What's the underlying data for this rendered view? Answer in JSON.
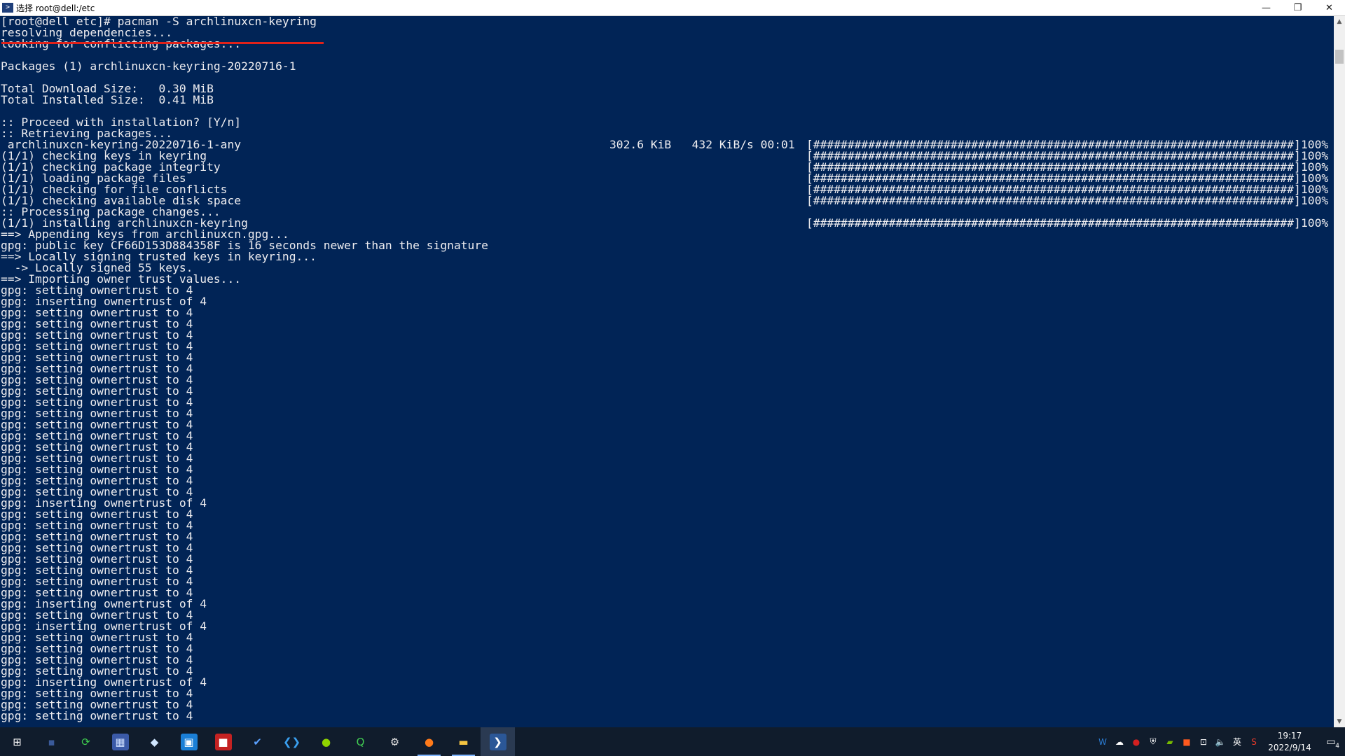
{
  "window": {
    "icon_name": "powershell-icon",
    "title": "选择 root@dell:/etc",
    "controls": {
      "minimize": "—",
      "maximize": "❐",
      "close": "✕"
    }
  },
  "console": {
    "lines": [
      {
        "text": "[root@dell etc]# pacman -S archlinuxcn-keyring"
      },
      {
        "text": "resolving dependencies..."
      },
      {
        "text": "looking for conflicting packages..."
      },
      {
        "text": ""
      },
      {
        "text": "Packages (1) archlinuxcn-keyring-20220716-1"
      },
      {
        "text": ""
      },
      {
        "text": "Total Download Size:   0.30 MiB"
      },
      {
        "text": "Total Installed Size:  0.41 MiB"
      },
      {
        "text": ""
      },
      {
        "text": ":: Proceed with installation? [Y/n]"
      },
      {
        "text": ":: Retrieving packages..."
      },
      {
        "text": " archlinuxcn-keyring-20220716-1-any",
        "stats": "302.6 KiB   432 KiB/s 00:01",
        "bar": "[######################################################################]",
        "pct": "100%"
      },
      {
        "text": "(1/1) checking keys in keyring",
        "bar": "[######################################################################]",
        "pct": "100%"
      },
      {
        "text": "(1/1) checking package integrity",
        "bar": "[######################################################################]",
        "pct": "100%"
      },
      {
        "text": "(1/1) loading package files",
        "bar": "[######################################################################]",
        "pct": "100%"
      },
      {
        "text": "(1/1) checking for file conflicts",
        "bar": "[######################################################################]",
        "pct": "100%"
      },
      {
        "text": "(1/1) checking available disk space",
        "bar": "[######################################################################]",
        "pct": "100%"
      },
      {
        "text": ":: Processing package changes..."
      },
      {
        "text": "(1/1) installing archlinuxcn-keyring",
        "bar": "[######################################################################]",
        "pct": "100%"
      },
      {
        "text": "==> Appending keys from archlinuxcn.gpg..."
      },
      {
        "text": "gpg: public key CF66D153D884358F is 16 seconds newer than the signature"
      },
      {
        "text": "==> Locally signing trusted keys in keyring..."
      },
      {
        "text": "  -> Locally signed 55 keys."
      },
      {
        "text": "==> Importing owner trust values..."
      },
      {
        "text": "gpg: setting ownertrust to 4"
      },
      {
        "text": "gpg: inserting ownertrust of 4"
      },
      {
        "text": "gpg: setting ownertrust to 4"
      },
      {
        "text": "gpg: setting ownertrust to 4"
      },
      {
        "text": "gpg: setting ownertrust to 4"
      },
      {
        "text": "gpg: setting ownertrust to 4"
      },
      {
        "text": "gpg: setting ownertrust to 4"
      },
      {
        "text": "gpg: setting ownertrust to 4"
      },
      {
        "text": "gpg: setting ownertrust to 4"
      },
      {
        "text": "gpg: setting ownertrust to 4"
      },
      {
        "text": "gpg: setting ownertrust to 4"
      },
      {
        "text": "gpg: setting ownertrust to 4"
      },
      {
        "text": "gpg: setting ownertrust to 4"
      },
      {
        "text": "gpg: setting ownertrust to 4"
      },
      {
        "text": "gpg: setting ownertrust to 4"
      },
      {
        "text": "gpg: setting ownertrust to 4"
      },
      {
        "text": "gpg: setting ownertrust to 4"
      },
      {
        "text": "gpg: setting ownertrust to 4"
      },
      {
        "text": "gpg: setting ownertrust to 4"
      },
      {
        "text": "gpg: inserting ownertrust of 4"
      },
      {
        "text": "gpg: setting ownertrust to 4"
      },
      {
        "text": "gpg: setting ownertrust to 4"
      },
      {
        "text": "gpg: setting ownertrust to 4"
      },
      {
        "text": "gpg: setting ownertrust to 4"
      },
      {
        "text": "gpg: setting ownertrust to 4"
      },
      {
        "text": "gpg: setting ownertrust to 4"
      },
      {
        "text": "gpg: setting ownertrust to 4"
      },
      {
        "text": "gpg: setting ownertrust to 4"
      },
      {
        "text": "gpg: inserting ownertrust of 4"
      },
      {
        "text": "gpg: setting ownertrust to 4"
      },
      {
        "text": "gpg: inserting ownertrust of 4"
      },
      {
        "text": "gpg: setting ownertrust to 4"
      },
      {
        "text": "gpg: setting ownertrust to 4"
      },
      {
        "text": "gpg: setting ownertrust to 4"
      },
      {
        "text": "gpg: setting ownertrust to 4"
      },
      {
        "text": "gpg: inserting ownertrust of 4"
      },
      {
        "text": "gpg: setting ownertrust to 4"
      },
      {
        "text": "gpg: setting ownertrust to 4"
      },
      {
        "text": "gpg: setting ownertrust to 4"
      }
    ],
    "colors": {
      "background": "#012456",
      "foreground": "#eeedf0",
      "highlight_underline": "#e0221a"
    }
  },
  "taskbar": {
    "apps": [
      {
        "name": "start-button",
        "icon": "windows-logo-icon",
        "glyph": "⊞",
        "color": "#ffffff",
        "bg": "transparent",
        "state": ""
      },
      {
        "name": "taskbar-app-1",
        "icon": "dark-app-icon",
        "glyph": "▪",
        "color": "#3a5a9a",
        "bg": "transparent",
        "state": ""
      },
      {
        "name": "taskbar-app-2",
        "icon": "sync-icon",
        "glyph": "⟳",
        "color": "#3fcf4f",
        "bg": "transparent",
        "state": ""
      },
      {
        "name": "taskbar-app-3",
        "icon": "calculator-icon",
        "glyph": "▦",
        "color": "#cfe0ff",
        "bg": "#3b5aa8",
        "state": ""
      },
      {
        "name": "taskbar-app-4",
        "icon": "notes-icon",
        "glyph": "◆",
        "color": "#cfe6ff",
        "bg": "transparent",
        "state": ""
      },
      {
        "name": "taskbar-app-5",
        "icon": "photo-app-icon",
        "glyph": "▣",
        "color": "#ffffff",
        "bg": "#1b7fd6",
        "state": ""
      },
      {
        "name": "taskbar-app-6",
        "icon": "pdf-reader-icon",
        "glyph": "■",
        "color": "#ffffff",
        "bg": "#c42222",
        "state": ""
      },
      {
        "name": "taskbar-app-7",
        "icon": "todo-check-icon",
        "glyph": "✔",
        "color": "#5aa0ff",
        "bg": "transparent",
        "state": ""
      },
      {
        "name": "taskbar-app-8",
        "icon": "vscode-icon",
        "glyph": "❮❯",
        "color": "#3aa0f0",
        "bg": "transparent",
        "state": ""
      },
      {
        "name": "taskbar-app-9",
        "icon": "network-tool-icon",
        "glyph": "●",
        "color": "#8fd400",
        "bg": "transparent",
        "state": ""
      },
      {
        "name": "taskbar-app-10",
        "icon": "qt-creator-icon",
        "glyph": "Q",
        "color": "#41cd52",
        "bg": "transparent",
        "state": ""
      },
      {
        "name": "taskbar-app-11",
        "icon": "settings-box-icon",
        "glyph": "⚙",
        "color": "#e0e0e0",
        "bg": "transparent",
        "state": ""
      },
      {
        "name": "taskbar-app-12",
        "icon": "firefox-icon",
        "glyph": "●",
        "color": "#ff7a1a",
        "bg": "transparent",
        "state": "running"
      },
      {
        "name": "taskbar-app-13",
        "icon": "file-explorer-icon",
        "glyph": "▬",
        "color": "#f5c542",
        "bg": "transparent",
        "state": "running"
      },
      {
        "name": "taskbar-app-14",
        "icon": "terminal-icon",
        "glyph": "❯",
        "color": "#ffffff",
        "bg": "#2b5797",
        "state": "active"
      }
    ],
    "tray": [
      {
        "name": "tray-word-icon",
        "glyph": "W",
        "color": "#2b7cd3"
      },
      {
        "name": "tray-cloud-icon",
        "glyph": "☁",
        "color": "#ffffff"
      },
      {
        "name": "tray-red-app-icon",
        "glyph": "●",
        "color": "#d42020"
      },
      {
        "name": "tray-shield-icon",
        "glyph": "⛨",
        "color": "#ffffff"
      },
      {
        "name": "tray-nvidia-icon",
        "glyph": "▰",
        "color": "#76b900"
      },
      {
        "name": "tray-orange-app-icon",
        "glyph": "■",
        "color": "#ff5a1f"
      },
      {
        "name": "tray-network-icon",
        "glyph": "⊡",
        "color": "#ffffff"
      },
      {
        "name": "tray-volume-icon",
        "glyph": "🔈",
        "color": "#ffffff"
      },
      {
        "name": "tray-ime-icon",
        "glyph": "英",
        "color": "#ffffff"
      },
      {
        "name": "tray-sogou-icon",
        "glyph": "S",
        "color": "#e63a2a"
      }
    ],
    "clock": {
      "time": "19:17",
      "date": "2022/9/14"
    },
    "notifications": {
      "icon": "action-center-icon",
      "glyph": "▭",
      "count": "4"
    }
  }
}
